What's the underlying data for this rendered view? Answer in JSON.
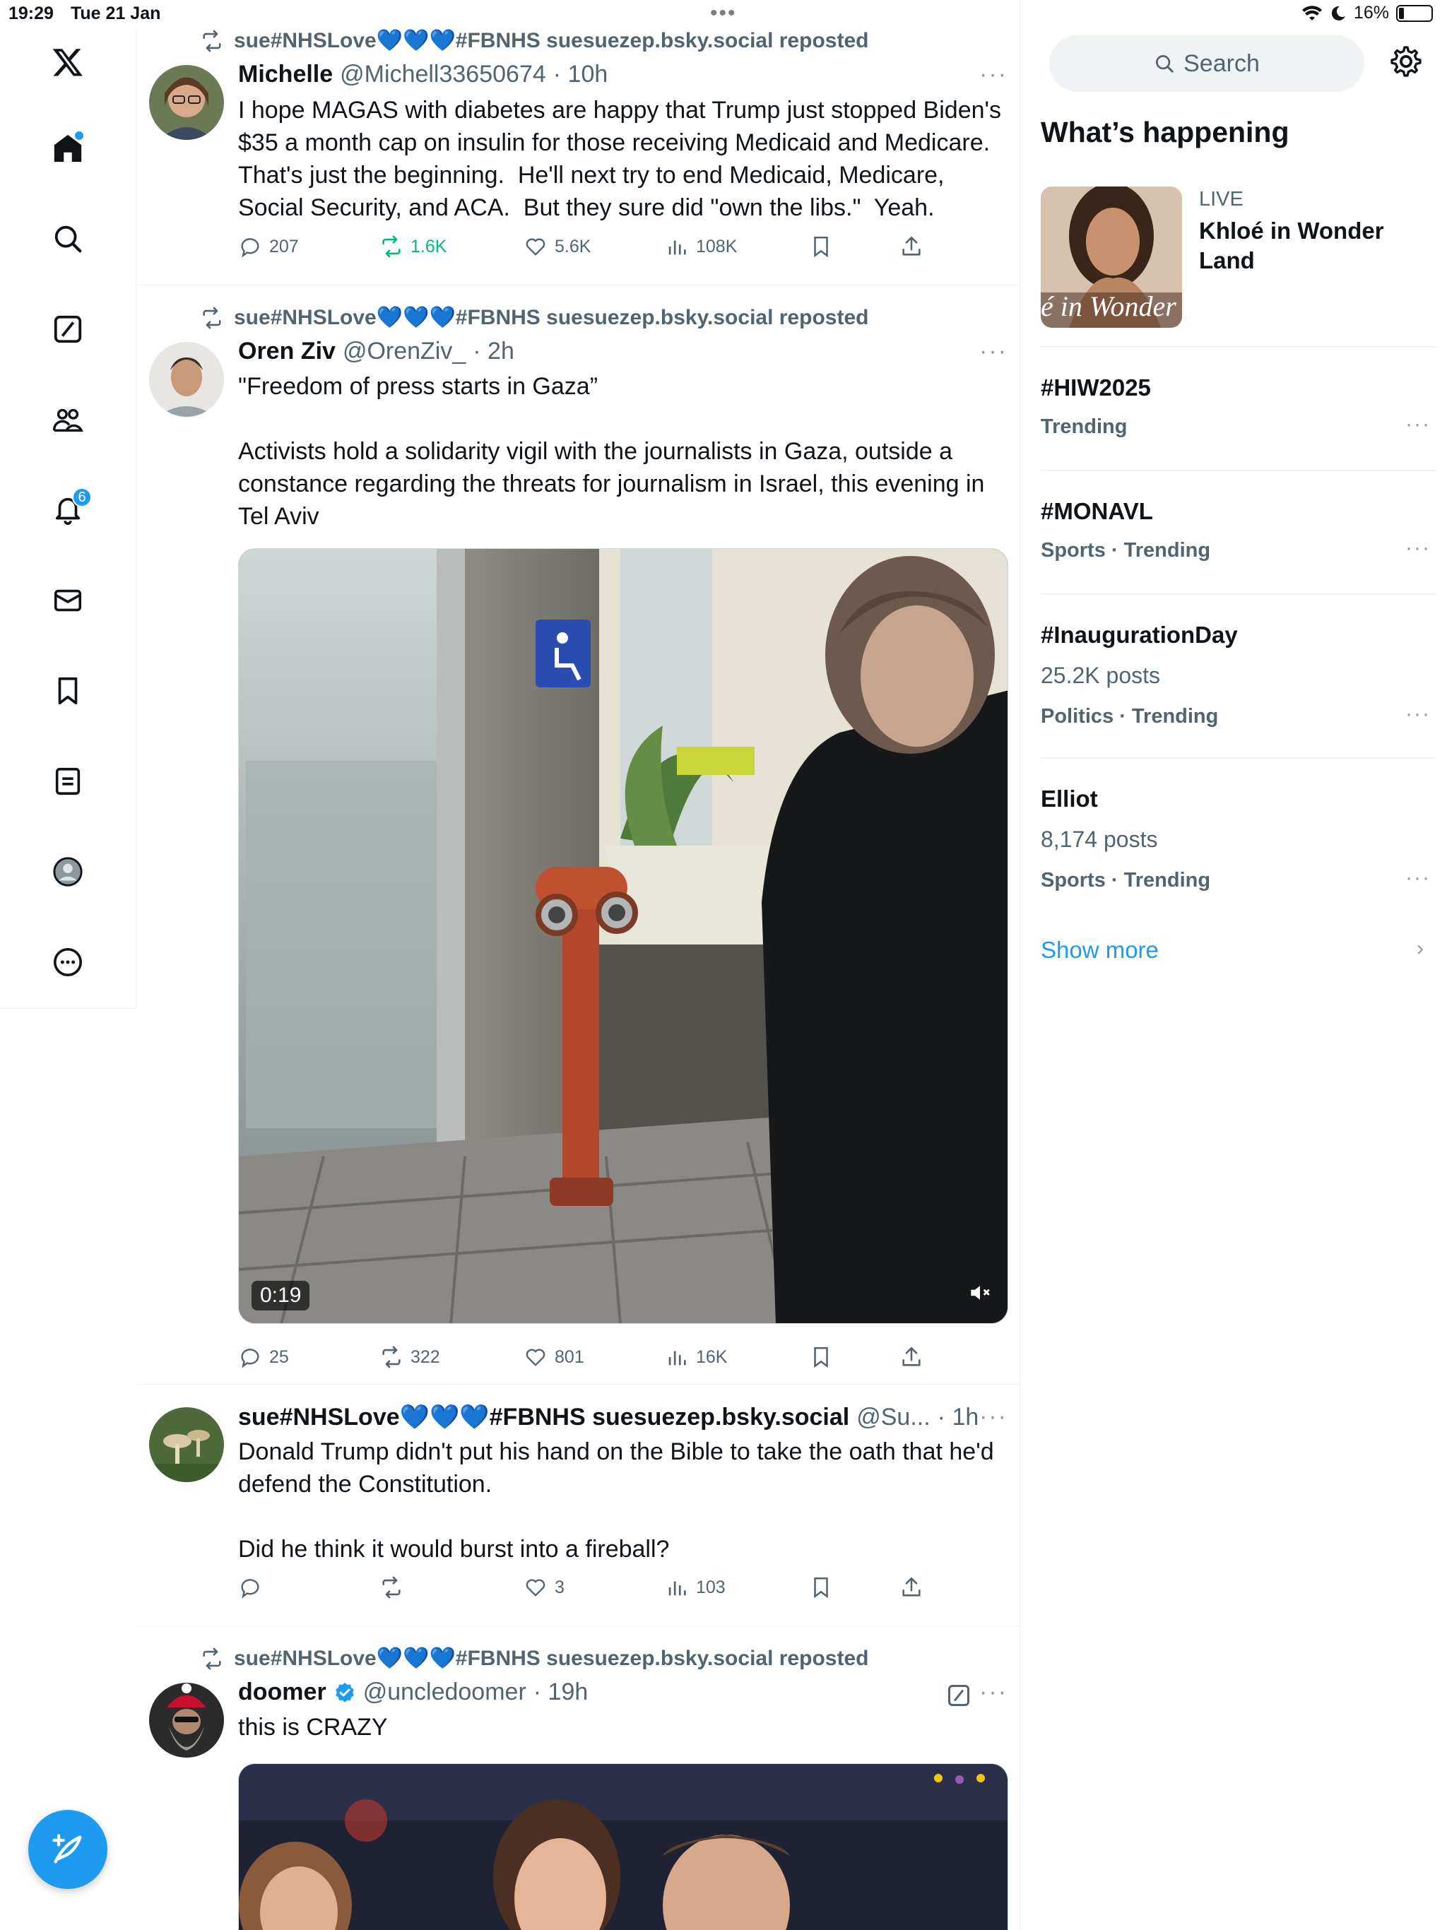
{
  "status_bar": {
    "time": "19:29",
    "date": "Tue 21 Jan",
    "battery": "16%",
    "battery_level": 0.16
  },
  "nav": {
    "notifications_badge": "6"
  },
  "timeline": {
    "posts": [
      {
        "repost_by": "sue#NHSLove💙💙💙#FBNHS suesuezep.bsky.social reposted",
        "name": "Michelle",
        "handle": "@Michell33650674",
        "time": "· 10h",
        "text": "I hope MAGAS with diabetes are happy that Trump just stopped Biden's $35 a month cap on insulin for those receiving Medicaid and Medicare. That's just the beginning.  He'll next try to end Medicaid, Medicare, Social Security, and ACA.  But they sure did \"own the libs.\"  Yeah.",
        "replies": "207",
        "reposts": "1.6K",
        "likes": "5.6K",
        "views": "108K"
      },
      {
        "repost_by": "sue#NHSLove💙💙💙#FBNHS suesuezep.bsky.social reposted",
        "name": "Oren Ziv",
        "handle": "@OrenZiv_",
        "time": "· 2h",
        "text": "\"Freedom of press starts in Gaza”\n\nActivists hold a solidarity vigil with the journalists in Gaza, outside a constance regarding the threats for journalism in Israel, this evening in Tel Aviv",
        "video_duration": "0:19",
        "replies": "25",
        "reposts": "322",
        "likes": "801",
        "views": "16K"
      },
      {
        "name": "sue#NHSLove💙💙💙#FBNHS suesuezep.bsky.social",
        "handle": "@Su...",
        "time": "· 1h",
        "text": "Donald Trump didn't put his hand on the Bible to take the oath that he'd defend the Constitution.\n\nDid he think it would burst into a fireball?",
        "likes": "3",
        "views": "103"
      },
      {
        "repost_by": "sue#NHSLove💙💙💙#FBNHS suesuezep.bsky.social reposted",
        "name": "doomer",
        "handle": "@uncledoomer",
        "time": "· 19h",
        "text": "this is CRAZY"
      }
    ]
  },
  "sidebar": {
    "search_placeholder": "Search",
    "title": "What’s happening",
    "live": {
      "label": "LIVE",
      "title": "Khloé in Wonder Land",
      "thumb_text": "é in Wonder L"
    },
    "trends": [
      {
        "name": "#HIW2025",
        "meta": "Trending"
      },
      {
        "name": "#MONAVL",
        "meta": "Sports · Trending"
      },
      {
        "name": "#InaugurationDay",
        "posts": "25.2K posts",
        "meta": "Politics · Trending"
      },
      {
        "name": "Elliot",
        "posts": "8,174 posts",
        "meta": "Sports · Trending"
      }
    ],
    "show_more": "Show more"
  },
  "colors": {
    "accent": "#1d9bf0",
    "repost_green": "#00ba7c",
    "secondary_text": "#536471"
  },
  "icons": [
    "x-logo-icon",
    "home-icon",
    "search-icon",
    "grok-icon",
    "communities-icon",
    "bell-icon",
    "mail-icon",
    "bookmark-icon",
    "lists-icon",
    "profile-icon",
    "more-circle-icon",
    "compose-icon",
    "gear-icon",
    "reply-icon",
    "repost-icon",
    "like-icon",
    "views-icon",
    "share-icon",
    "mute-icon",
    "verified-icon"
  ]
}
